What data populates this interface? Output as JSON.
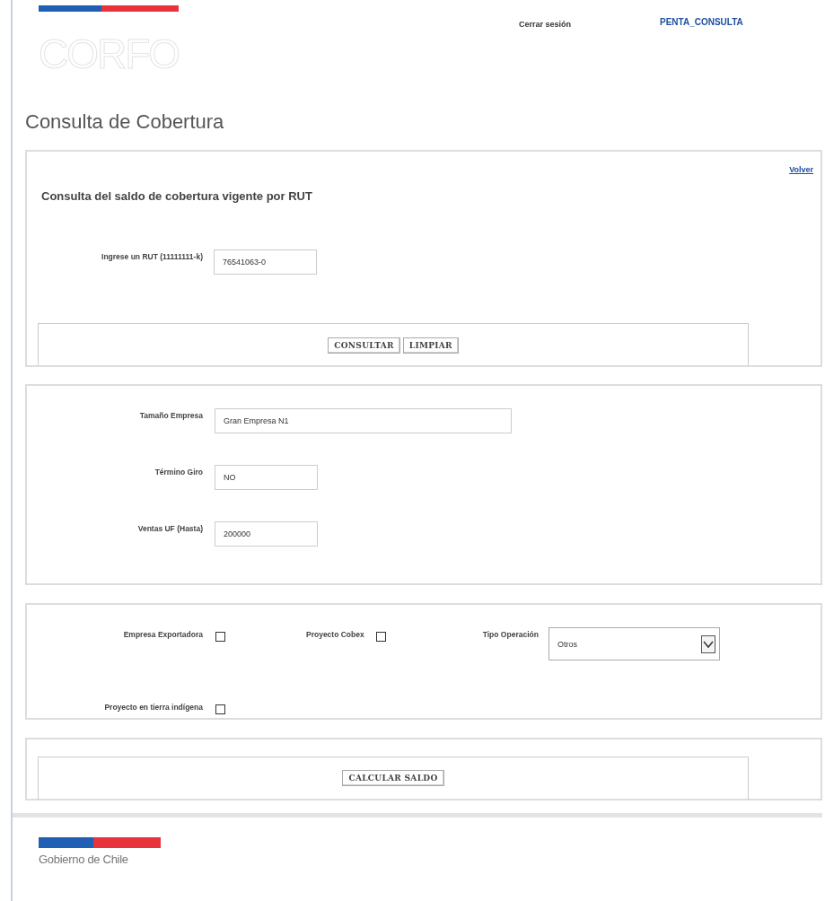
{
  "header": {
    "logout": "Cerrar sesión",
    "user": "PENTA_CONSULTA",
    "logo": "CORFO"
  },
  "page_title": "Consulta de Cobertura",
  "query_panel": {
    "back_link": "Volver",
    "heading": "Consulta del saldo de cobertura vigente por RUT",
    "rut_label": "Ingrese un RUT (11111111-k)",
    "rut_value": "76541063-0",
    "buttons": [
      "CONSULTAR",
      "LIMPIAR"
    ]
  },
  "company_panel": {
    "fields": [
      {
        "label": "Tamaño Empresa",
        "value": "Gran Empresa N1",
        "kind": "wide"
      },
      {
        "label": "Término Giro",
        "value": "NO",
        "kind": "short"
      },
      {
        "label": "Ventas UF (Hasta)",
        "value": "200000",
        "kind": "short"
      }
    ]
  },
  "options_panel": {
    "checkboxes": [
      {
        "label": "Empresa Exportadora",
        "checked": false
      },
      {
        "label": "Proyecto Cobex",
        "checked": false
      },
      {
        "label": "Proyecto en tierra indígena",
        "checked": false
      }
    ],
    "operation_label": "Tipo Operación",
    "operation_value": "Otros"
  },
  "calc_button": "CALCULAR SALDO",
  "footer": {
    "text": "Gobierno de Chile"
  }
}
